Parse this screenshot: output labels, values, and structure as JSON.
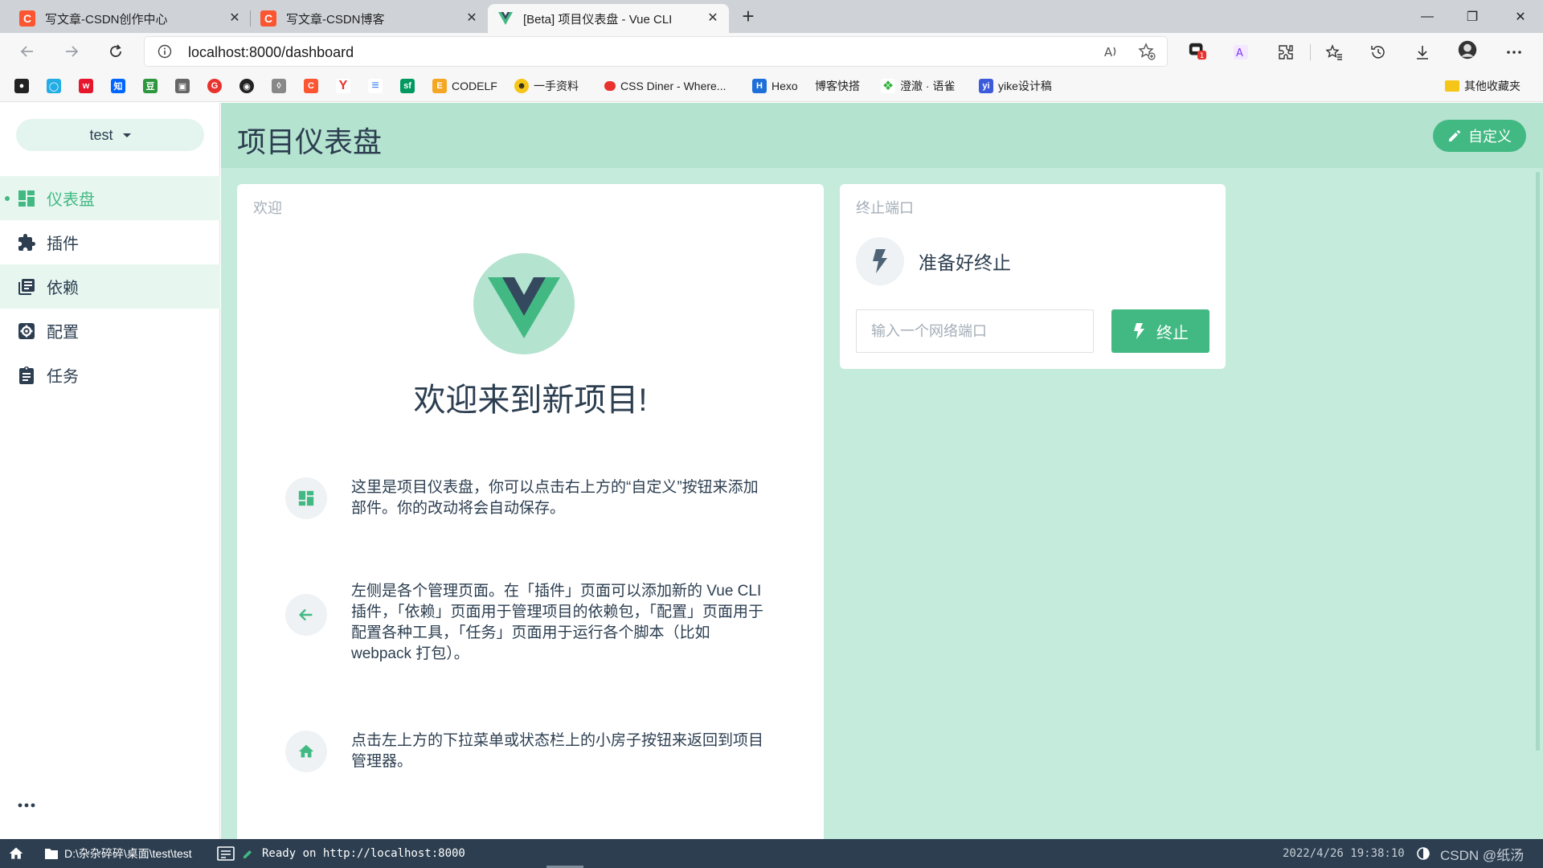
{
  "browser": {
    "tabs": [
      {
        "title": "写文章-CSDN创作中心",
        "favicon": "csdn-icon",
        "active": false
      },
      {
        "title": "写文章-CSDN博客",
        "favicon": "csdn-icon",
        "active": false
      },
      {
        "title": "[Beta] 项目仪表盘 - Vue CLI",
        "favicon": "vue-icon",
        "active": true
      }
    ],
    "url": "localhost:8000/dashboard",
    "extension_badge": "1",
    "bookmarks": [
      {
        "label": "",
        "icon": "github-cat-icon",
        "color": "#222222"
      },
      {
        "label": "",
        "icon": "bilibili-icon",
        "color": "#23ade5"
      },
      {
        "label": "",
        "icon": "weibo-icon",
        "color": "#e6162d"
      },
      {
        "label": "",
        "icon": "zhihu-icon",
        "color": "#0066ff"
      },
      {
        "label": "",
        "icon": "douban-icon",
        "color": "#2e963d"
      },
      {
        "label": "",
        "icon": "image-icon",
        "color": "#666666"
      },
      {
        "label": "",
        "icon": "g-icon",
        "color": "#e8322d"
      },
      {
        "label": "",
        "icon": "github-icon",
        "color": "#222222"
      },
      {
        "label": "",
        "icon": "bookmark-icon",
        "color": "#888888"
      },
      {
        "label": "",
        "icon": "csdn-icon",
        "color": "#fc5531"
      },
      {
        "label": "",
        "icon": "y-icon",
        "color": "#e8322d"
      },
      {
        "label": "",
        "icon": "layers-icon",
        "color": "#3b82f6"
      },
      {
        "label": "",
        "icon": "segmentfault-icon",
        "color": "#009a61"
      },
      {
        "label": "CODELF",
        "icon": "codelf-icon",
        "color": "#f5a623"
      },
      {
        "label": "一手资料",
        "icon": "emoji-icon",
        "color": "#f5c518"
      },
      {
        "label": "CSS Diner - Where...",
        "icon": "css-diner-icon",
        "color": "#e8322d"
      },
      {
        "label": "Hexo",
        "icon": "hexo-icon",
        "color": "#1e6fd9"
      },
      {
        "label": "博客快搭",
        "icon": "",
        "color": ""
      },
      {
        "label": "澄澈 · 语雀",
        "icon": "yuque-icon",
        "color": "#2fb23d"
      },
      {
        "label": "yike设计稿",
        "icon": "yike-icon",
        "color": "#3b5bdb"
      },
      {
        "label": "其他收藏夹",
        "icon": "folder-icon",
        "color": "#f5c518"
      }
    ]
  },
  "sidebar": {
    "project": "test",
    "items": [
      {
        "label": "仪表盘",
        "icon": "dashboard-icon",
        "selected": true
      },
      {
        "label": "插件",
        "icon": "puzzle-icon",
        "selected": false
      },
      {
        "label": "依赖",
        "icon": "library-icon",
        "selected": false
      },
      {
        "label": "配置",
        "icon": "settings-icon",
        "selected": false
      },
      {
        "label": "任务",
        "icon": "clipboard-icon",
        "selected": false
      }
    ],
    "tooltip": "依赖"
  },
  "header": {
    "title": "项目仪表盘",
    "customize": "自定义"
  },
  "welcome": {
    "card_title": "欢迎",
    "heading": "欢迎来到新项目!",
    "tips": [
      {
        "icon": "dashboard-icon",
        "text": "这里是项目仪表盘，你可以点击右上方的“自定义”按钮来添加部件。你的改动将会自动保存。"
      },
      {
        "icon": "arrow-left-icon",
        "text": "左侧是各个管理页面。在「插件」页面可以添加新的 Vue CLI 插件，「依赖」页面用于管理项目的依赖包，「配置」页面用于配置各种工具，「任务」页面用于运行各个脚本（比如 webpack 打包）。"
      },
      {
        "icon": "home-icon",
        "text": "点击左上方的下拉菜单或状态栏上的小房子按钮来返回到项目管理器。"
      }
    ]
  },
  "kill_port": {
    "card_title": "终止端口",
    "status": "准备好终止",
    "placeholder": "输入一个网络端口",
    "button": "终止"
  },
  "statusbar": {
    "path": "D:\\杂杂碎碎\\桌面\\test\\test",
    "log": "Ready on http://localhost:8000",
    "time": "2022/4/26 19:38:10",
    "watermark": "CSDN @纸汤"
  },
  "colors": {
    "accent": "#42b983",
    "text": "#2c3e50",
    "statusbar": "#2c3e50",
    "main_bg": "#c4ebdc"
  }
}
